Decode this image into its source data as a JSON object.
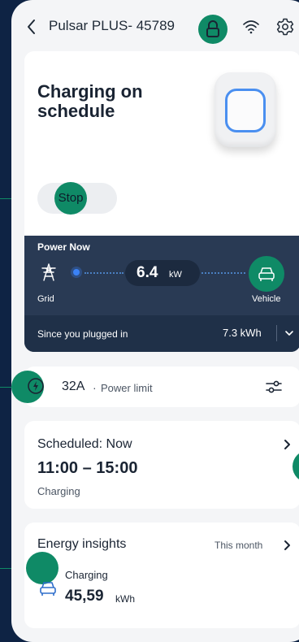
{
  "header": {
    "device_name": "Pulsar PLUS- 45789",
    "back_icon": "chevron-left-icon",
    "lock_icon": "lock-icon",
    "wifi_icon": "wifi-icon",
    "settings_icon": "gear-icon"
  },
  "status": {
    "title": "Charging on schedule",
    "stop_label": "Stop"
  },
  "power": {
    "title": "Power Now",
    "value": "6.4",
    "unit": "kW",
    "grid_label": "Grid",
    "vehicle_label": "Vehicle",
    "since_label": "Since you plugged in",
    "since_value": "7.3 kWh"
  },
  "limit": {
    "value": "32A",
    "separator": "·",
    "label": "Power limit"
  },
  "schedule": {
    "title": "Scheduled: Now",
    "time": "11:00 – 15:00",
    "status": "Charging"
  },
  "energy": {
    "title": "Energy insights",
    "period": "This month",
    "label": "Charging",
    "value": "45,59",
    "unit": "kWh"
  },
  "colors": {
    "accent": "#0f8a66",
    "background": "#0e2344",
    "panel": "#293a54",
    "flow": "#3b82f6"
  }
}
